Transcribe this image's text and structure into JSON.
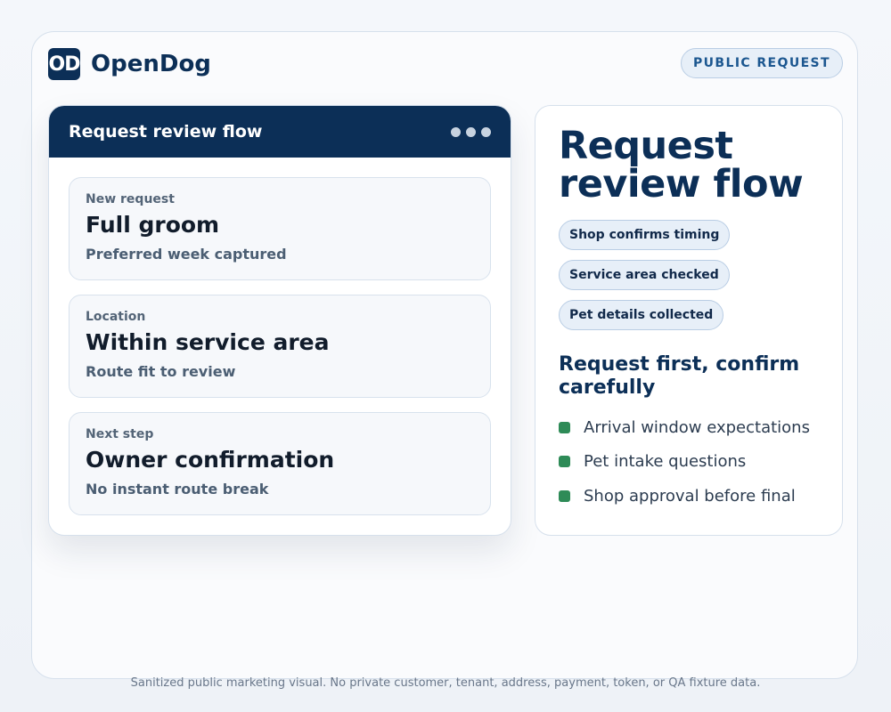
{
  "brand": {
    "logo_text": "OD",
    "name": "OpenDog"
  },
  "badge": {
    "label": "PUBLIC REQUEST"
  },
  "flow_card": {
    "title": "Request review flow",
    "steps": [
      {
        "label": "New request",
        "title": "Full groom",
        "subtitle": "Preferred week captured"
      },
      {
        "label": "Location",
        "title": "Within service area",
        "subtitle": "Route fit to review"
      },
      {
        "label": "Next step",
        "title": "Owner confirmation",
        "subtitle": "No instant route break"
      }
    ]
  },
  "info_card": {
    "title": "Request review flow",
    "tags": [
      "Shop confirms timing",
      "Service area checked",
      "Pet details collected"
    ],
    "heading": "Request first, confirm carefully",
    "checklist": [
      "Arrival window expectations",
      "Pet intake questions",
      "Shop approval before final"
    ],
    "check_color": "#2e8b57"
  },
  "footer": {
    "text": "Sanitized public marketing visual. No private customer, tenant, address, payment, token, or QA fixture data."
  },
  "colors": {
    "brand_navy": "#0c2f57",
    "badge_blue": "#1c5790",
    "check_green": "#2e8b57"
  }
}
